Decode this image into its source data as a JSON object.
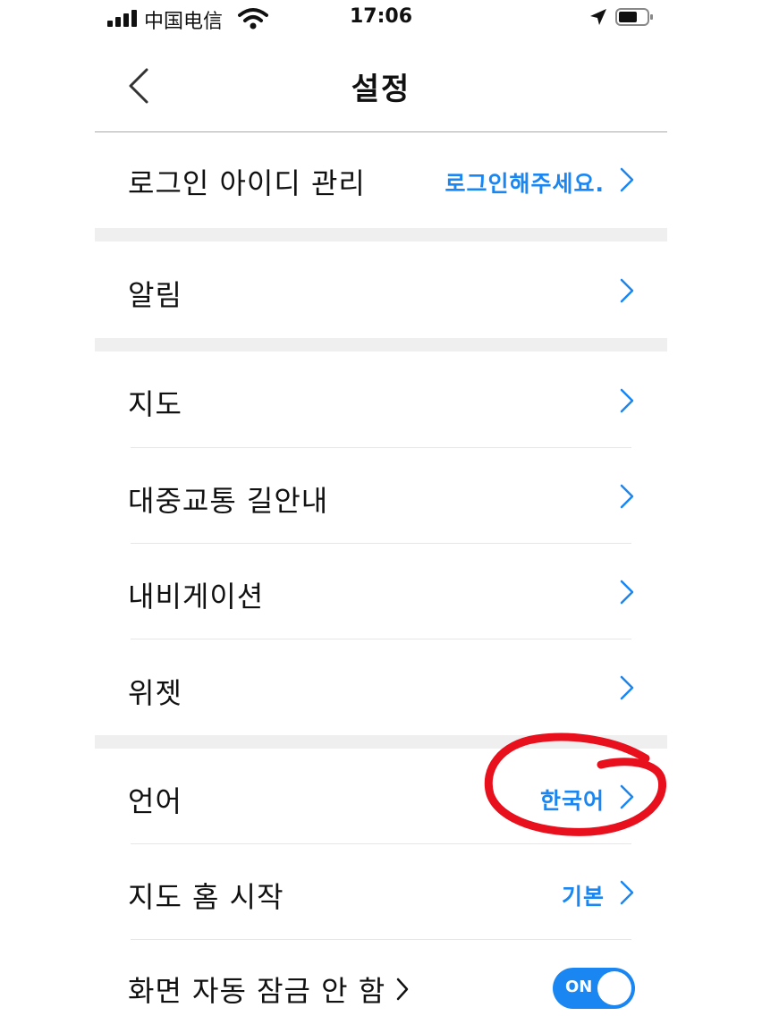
{
  "status_bar": {
    "carrier": "中国电信",
    "time": "17:06"
  },
  "nav": {
    "title": "설정"
  },
  "rows": {
    "login": {
      "label": "로그인 아이디 관리",
      "value": "로그인해주세요."
    },
    "notifications": {
      "label": "알림"
    },
    "map": {
      "label": "지도"
    },
    "transit": {
      "label": "대중교통 길안내"
    },
    "navigation": {
      "label": "내비게이션"
    },
    "widget": {
      "label": "위젯"
    },
    "language": {
      "label": "언어",
      "value": "한국어"
    },
    "map_home": {
      "label": "지도 홈 시작",
      "value": "기본"
    },
    "screen_lock": {
      "label": "화면 자동 잠금 안 함",
      "toggle": "ON"
    }
  },
  "colors": {
    "accent": "#1a86f2",
    "annotation": "#e8101c",
    "section_band": "#efefef"
  },
  "icons": [
    "signal-icon",
    "wifi-icon",
    "location-arrow-icon",
    "battery-icon",
    "back-chevron-icon",
    "chevron-right-icon"
  ]
}
